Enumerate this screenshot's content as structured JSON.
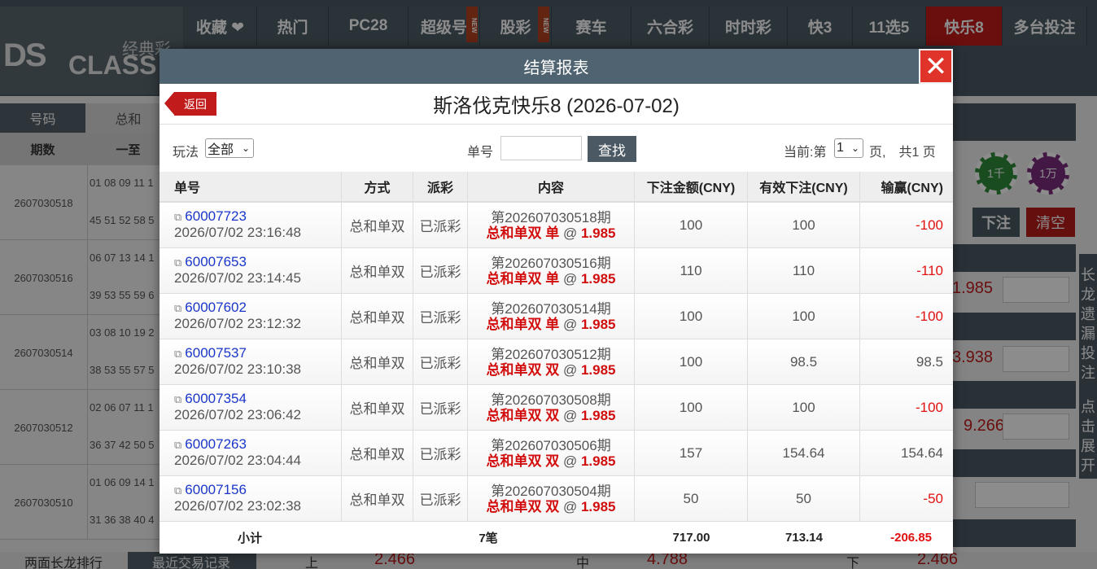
{
  "background": {
    "logo": {
      "mark": "DS",
      "brand_cn": "经典彩",
      "brand_en": "CLASS"
    },
    "nav": [
      {
        "label": "收藏 ❤",
        "new": false,
        "active": false
      },
      {
        "label": "热门",
        "new": false,
        "active": false
      },
      {
        "label": "PC28",
        "new": false,
        "active": false
      },
      {
        "label": "超级号",
        "new": true,
        "active": false
      },
      {
        "label": "股彩",
        "new": true,
        "active": false
      },
      {
        "label": "赛车",
        "new": false,
        "active": false
      },
      {
        "label": "六合彩",
        "new": false,
        "active": false
      },
      {
        "label": "时时彩",
        "new": false,
        "active": false
      },
      {
        "label": "快3",
        "new": false,
        "active": false
      },
      {
        "label": "11选5",
        "new": false,
        "active": false
      },
      {
        "label": "快乐8",
        "new": false,
        "active": true
      },
      {
        "label": "多台投注",
        "new": false,
        "active": false
      }
    ],
    "new_tag": "NEW",
    "tabs": [
      "号码",
      "总和"
    ],
    "history_header": [
      "期数",
      "一至"
    ],
    "history": [
      {
        "period": "2607030518",
        "n1": "01 08 09 11 1",
        "n2": "45 51 52 58 5"
      },
      {
        "period": "2607030516",
        "n1": "06 07 13 14 1",
        "n2": "39 53 55 59 6"
      },
      {
        "period": "2607030514",
        "n1": "03 08 10 19 2",
        "n2": "38 53 55 57 5"
      },
      {
        "period": "2607030512",
        "n1": "02 06 07 11 1",
        "n2": "36 37 42 50 5"
      },
      {
        "period": "2607030510",
        "n1": "01 06 09 14 1",
        "n2": "31 36 38 40 4"
      }
    ],
    "chips": [
      "1千",
      "1万"
    ],
    "bet_button": "下注",
    "clear_button": "清空",
    "odds": [
      "1.985",
      "3.938",
      "9.266"
    ],
    "side_text": [
      "长",
      "龙",
      "遗",
      "漏",
      "投",
      "注",
      "点",
      "击",
      "展",
      "开"
    ],
    "bottom": {
      "left1": "两面长龙排行",
      "left2": "最近交易记录",
      "up": "上",
      "up_val": "2.466",
      "mid": "中",
      "mid_val": "4.788",
      "down": "下",
      "down_val": "2.466"
    }
  },
  "modal": {
    "title": "结算报表",
    "close_label": "✕",
    "back_label": "返回",
    "subtitle": "斯洛伐克快乐8 (2026-07-02)",
    "filter": {
      "play_label": "玩法",
      "play_value": "全部",
      "order_label": "单号",
      "order_value": "",
      "search_label": "查找",
      "current_prefix": "当前:第",
      "current_page": "1",
      "page_suffix": "页,　共1 页"
    },
    "columns": [
      "单号",
      "方式",
      "派彩",
      "内容",
      "下注金额(CNY)",
      "有效下注(CNY)",
      "输赢(CNY)"
    ],
    "rows": [
      {
        "id": "60007723",
        "time": "2026/07/02 23:16:48",
        "method": "总和单双",
        "status": "已派彩",
        "period": "第202607030518期",
        "bet": "总和单双 单",
        "at": "@",
        "odds": "1.985",
        "amount": "100",
        "valid": "100",
        "result": "-100",
        "neg": true
      },
      {
        "id": "60007653",
        "time": "2026/07/02 23:14:45",
        "method": "总和单双",
        "status": "已派彩",
        "period": "第202607030516期",
        "bet": "总和单双 单",
        "at": "@",
        "odds": "1.985",
        "amount": "110",
        "valid": "110",
        "result": "-110",
        "neg": true
      },
      {
        "id": "60007602",
        "time": "2026/07/02 23:12:32",
        "method": "总和单双",
        "status": "已派彩",
        "period": "第202607030514期",
        "bet": "总和单双 单",
        "at": "@",
        "odds": "1.985",
        "amount": "100",
        "valid": "100",
        "result": "-100",
        "neg": true
      },
      {
        "id": "60007537",
        "time": "2026/07/02 23:10:38",
        "method": "总和单双",
        "status": "已派彩",
        "period": "第202607030512期",
        "bet": "总和单双 双",
        "at": "@",
        "odds": "1.985",
        "amount": "100",
        "valid": "98.5",
        "result": "98.5",
        "neg": false
      },
      {
        "id": "60007354",
        "time": "2026/07/02 23:06:42",
        "method": "总和单双",
        "status": "已派彩",
        "period": "第202607030508期",
        "bet": "总和单双 双",
        "at": "@",
        "odds": "1.985",
        "amount": "100",
        "valid": "100",
        "result": "-100",
        "neg": true
      },
      {
        "id": "60007263",
        "time": "2026/07/02 23:04:44",
        "method": "总和单双",
        "status": "已派彩",
        "period": "第202607030506期",
        "bet": "总和单双 双",
        "at": "@",
        "odds": "1.985",
        "amount": "157",
        "valid": "154.64",
        "result": "154.64",
        "neg": false
      },
      {
        "id": "60007156",
        "time": "2026/07/02 23:02:38",
        "method": "总和单双",
        "status": "已派彩",
        "period": "第202607030504期",
        "bet": "总和单双 双",
        "at": "@",
        "odds": "1.985",
        "amount": "50",
        "valid": "50",
        "result": "-50",
        "neg": true
      }
    ],
    "subtotal": {
      "label": "小计",
      "count": "7笔",
      "amount": "717.00",
      "valid": "713.14",
      "result": "-206.85"
    }
  }
}
